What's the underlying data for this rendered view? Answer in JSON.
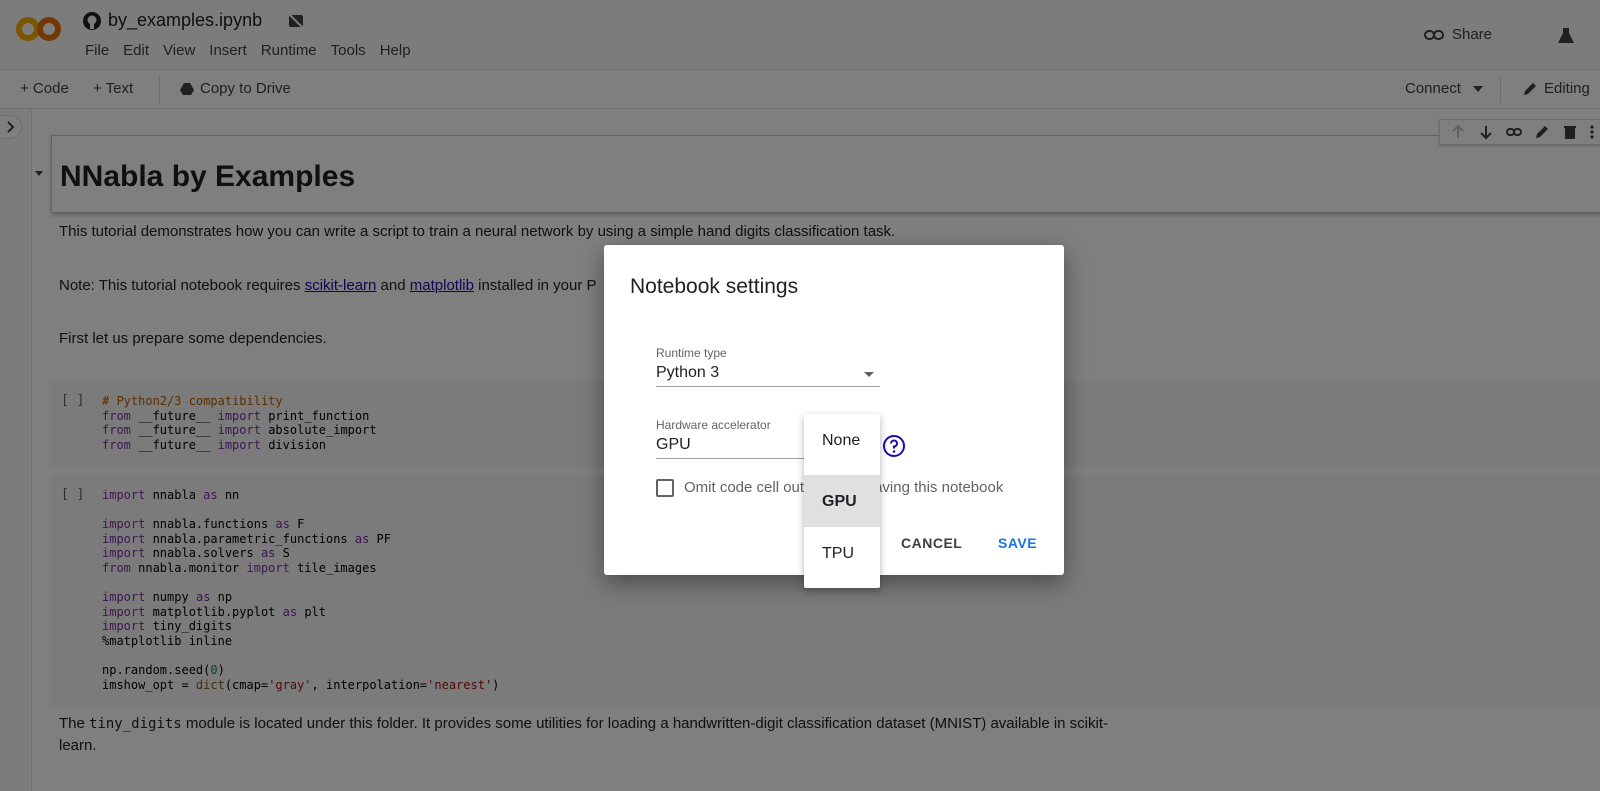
{
  "header": {
    "title": "by_examples.ipynb",
    "menu": [
      "File",
      "Edit",
      "View",
      "Insert",
      "Runtime",
      "Tools",
      "Help"
    ],
    "share_label": "Share"
  },
  "toolbar": {
    "code_label": "+ Code",
    "text_label": "+ Text",
    "copy_label": "Copy to Drive",
    "connect_label": "Connect",
    "editing_label": "Editing"
  },
  "notebook": {
    "heading": "NNabla by Examples",
    "intro": "This tutorial demonstrates how you can write a script to train a neural network by using a simple hand digits classification task.",
    "note_prefix": "Note: This tutorial notebook requires ",
    "note_link1": "scikit-learn",
    "note_and": " and ",
    "note_link2": "matplotlib",
    "note_suffix": " installed in your P",
    "prep": "First let us prepare some dependencies.",
    "run_bracket": "[ ]",
    "module_prefix": "The ",
    "module_code": "tiny_digits",
    "module_suffix": " module is located under this folder. It provides some utilities for loading a handwritten-digit classification dataset (MNIST) available in scikit-",
    "module_line2": "learn."
  },
  "dialog": {
    "title": "Notebook settings",
    "runtime_label": "Runtime type",
    "runtime_value": "Python 3",
    "hw_label": "Hardware accelerator",
    "hw_value": "GPU",
    "omit_label_visible_left": "Omit code cell out",
    "omit_label_visible_right": "aving this notebook",
    "cancel": "CANCEL",
    "save": "SAVE",
    "omit_checked": false
  },
  "dropdown": {
    "options": [
      "None",
      "GPU",
      "TPU"
    ],
    "selected": "GPU"
  },
  "colors": {
    "accent": "#1a73e8",
    "link": "#1a0dab",
    "logo_orange": "#f9ab00",
    "help_icon": "#1a0dab"
  }
}
